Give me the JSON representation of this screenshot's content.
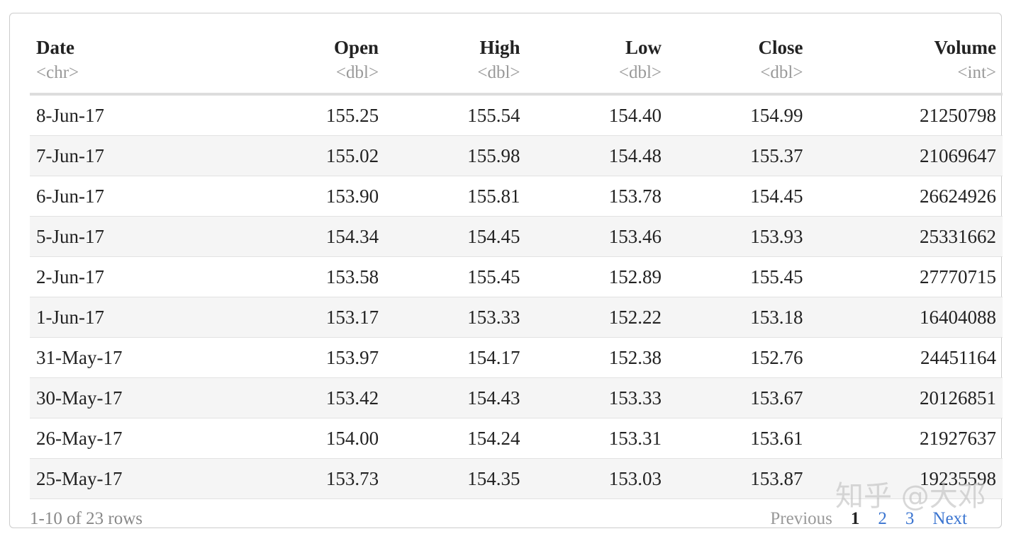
{
  "columns": [
    {
      "name": "Date",
      "type": "<chr>",
      "align": "l"
    },
    {
      "name": "Open",
      "type": "<dbl>",
      "align": "r"
    },
    {
      "name": "High",
      "type": "<dbl>",
      "align": "r"
    },
    {
      "name": "Low",
      "type": "<dbl>",
      "align": "r"
    },
    {
      "name": "Close",
      "type": "<dbl>",
      "align": "r"
    },
    {
      "name": "Volume",
      "type": "<int>",
      "align": "r"
    }
  ],
  "rows": [
    [
      "8-Jun-17",
      "155.25",
      "155.54",
      "154.40",
      "154.99",
      "21250798"
    ],
    [
      "7-Jun-17",
      "155.02",
      "155.98",
      "154.48",
      "155.37",
      "21069647"
    ],
    [
      "6-Jun-17",
      "153.90",
      "155.81",
      "153.78",
      "154.45",
      "26624926"
    ],
    [
      "5-Jun-17",
      "154.34",
      "154.45",
      "153.46",
      "153.93",
      "25331662"
    ],
    [
      "2-Jun-17",
      "153.58",
      "155.45",
      "152.89",
      "155.45",
      "27770715"
    ],
    [
      "1-Jun-17",
      "153.17",
      "153.33",
      "152.22",
      "153.18",
      "16404088"
    ],
    [
      "31-May-17",
      "153.97",
      "154.17",
      "152.38",
      "152.76",
      "24451164"
    ],
    [
      "30-May-17",
      "153.42",
      "154.43",
      "153.33",
      "153.67",
      "20126851"
    ],
    [
      "26-May-17",
      "154.00",
      "154.24",
      "153.31",
      "153.61",
      "21927637"
    ],
    [
      "25-May-17",
      "153.73",
      "154.35",
      "153.03",
      "153.87",
      "19235598"
    ]
  ],
  "footer": {
    "rows_info": "1-10 of 23 rows",
    "previous": "Previous",
    "pages": [
      "1",
      "2",
      "3"
    ],
    "current_page": "1",
    "next": "Next"
  },
  "watermark": "知乎 @大邓"
}
